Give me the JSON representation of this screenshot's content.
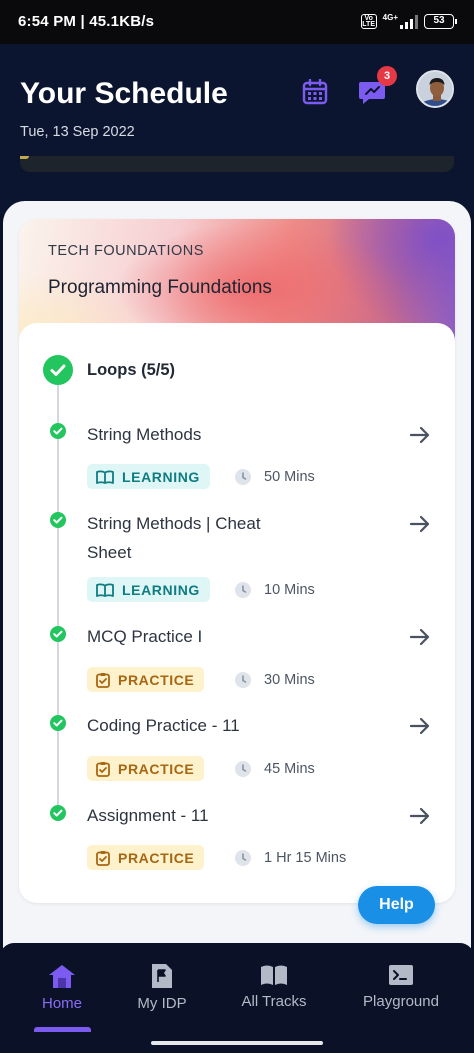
{
  "status_bar": {
    "time": "6:54 PM | 45.1KB/s",
    "volte": "Vo LTE",
    "network": "4G+",
    "battery": "53"
  },
  "header": {
    "title": "Your Schedule",
    "date": "Tue, 13 Sep 2022",
    "notification_count": "3",
    "progress_fraction": 0.02
  },
  "course": {
    "track_label": "TECH FOUNDATIONS",
    "title": "Programming Foundations",
    "module": {
      "title": "Loops (5/5)",
      "completed": true
    },
    "lessons": [
      {
        "title": "String Methods",
        "tag": "LEARNING",
        "duration": "50 Mins"
      },
      {
        "title": "String Methods | Cheat Sheet",
        "tag": "LEARNING",
        "duration": "10 Mins"
      },
      {
        "title": "MCQ Practice I",
        "tag": "PRACTICE",
        "duration": "30 Mins"
      },
      {
        "title": "Coding Practice - 11",
        "tag": "PRACTICE",
        "duration": "45 Mins"
      },
      {
        "title": "Assignment - 11",
        "tag": "PRACTICE",
        "duration": "1 Hr 15 Mins"
      }
    ]
  },
  "help_button": "Help",
  "nav": {
    "items": [
      {
        "label": "Home",
        "icon": "home-icon",
        "active": true
      },
      {
        "label": "My IDP",
        "icon": "flag-document-icon",
        "active": false
      },
      {
        "label": "All Tracks",
        "icon": "open-book-icon",
        "active": false
      },
      {
        "label": "Playground",
        "icon": "terminal-icon",
        "active": false
      }
    ]
  },
  "colors": {
    "header_bg": "#0c1530",
    "accent_purple": "#7c5cf0",
    "success_green": "#22c55e",
    "help_blue": "#1a8fe6",
    "learning_tag": "#0f7c80",
    "practice_tag": "#a76612"
  }
}
